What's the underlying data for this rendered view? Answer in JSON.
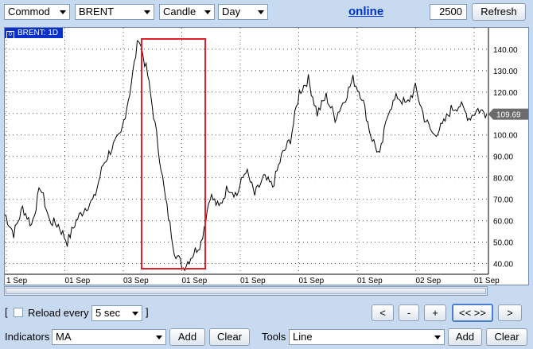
{
  "toolbar": {
    "category": "Commod",
    "symbol": "BRENT",
    "chart_type": "Candle",
    "period": "Day",
    "online_link": "online",
    "bars_value": "2500",
    "refresh_label": "Refresh"
  },
  "chart": {
    "tab_label": "BRENT: 1D",
    "tab_icon": "0",
    "current_price": "109.69",
    "y_ticks": [
      "140.00",
      "130.00",
      "120.00",
      "110.00",
      "100.00",
      "90.00",
      "80.00",
      "70.00",
      "60.00",
      "50.00",
      "40.00"
    ],
    "x_ticks": [
      "1 Sep",
      "01 Sep",
      "03 Sep",
      "01 Sep",
      "01 Sep",
      "01 Sep",
      "01 Sep",
      "02 Sep",
      "01 Sep"
    ],
    "highlight_color": "#e0202a",
    "line_color": "#000000"
  },
  "chart_data": {
    "type": "line",
    "title": "",
    "xlabel": "",
    "ylabel": "",
    "ylim": [
      35,
      147
    ],
    "x": [
      "1 Sep",
      "01 Sep",
      "03 Sep",
      "01 Sep",
      "01 Sep",
      "01 Sep",
      "01 Sep",
      "02 Sep",
      "01 Sep"
    ],
    "series": [
      {
        "values": [
          63,
          54,
          66,
          58,
          76,
          60,
          58,
          50,
          60,
          66,
          70,
          86,
          94,
          100,
          120,
          146,
          128,
          100,
          70,
          46,
          38,
          44,
          50,
          72,
          66,
          76,
          72,
          84,
          72,
          80,
          76,
          90,
          98,
          120,
          126,
          110,
          118,
          108,
          116,
          126,
          118,
          100,
          90,
          112,
          118,
          114,
          122,
          108,
          100,
          104,
          112,
          114,
          108,
          112,
          109.69
        ]
      }
    ]
  },
  "refresh_row": {
    "bracket_open": "[",
    "reload_label": "Reload every",
    "interval": "5 sec",
    "bracket_close": "]",
    "nav_back": "<",
    "zoom_out": "-",
    "zoom_in": "+",
    "nav_all": "<< >>",
    "nav_forward": ">"
  },
  "indicators": {
    "label": "Indicators",
    "value": "MA",
    "add_label": "Add",
    "clear_label": "Clear"
  },
  "tools": {
    "label": "Tools",
    "value": "Line",
    "add_label": "Add",
    "clear_label": "Clear"
  }
}
